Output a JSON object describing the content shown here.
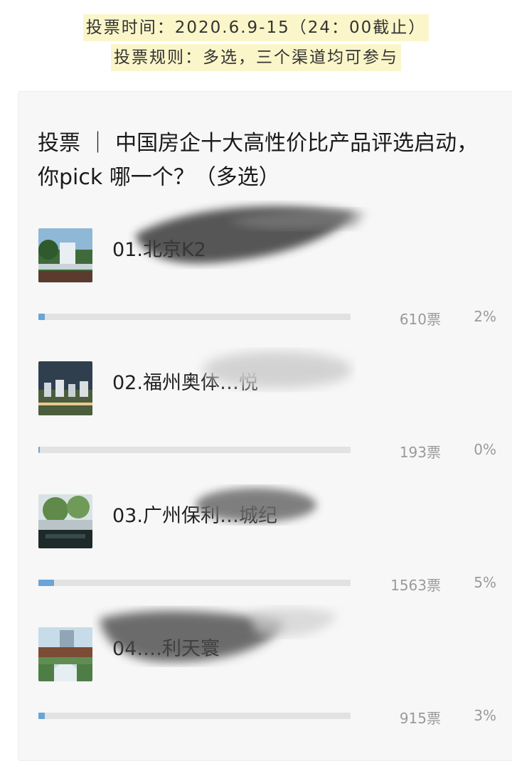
{
  "banner": {
    "line1": "投票时间：2020.6.9-15（24：00截止）",
    "line2": "投票规则：多选，三个渠道均可参与"
  },
  "poll": {
    "title": "投票 ｜ 中国房企十大高性价比产品评选启动，你pick 哪一个？（多选）",
    "options": [
      {
        "label": "01.北京K2",
        "votes": "610票",
        "percent": "2%",
        "fraction": 0.02
      },
      {
        "label": "02.福州奥体…悦",
        "votes": "193票",
        "percent": "0%",
        "fraction": 0.005
      },
      {
        "label": "03.广州保利…城纪",
        "votes": "1563票",
        "percent": "5%",
        "fraction": 0.05
      },
      {
        "label": "04.…利天寰",
        "votes": "915票",
        "percent": "3%",
        "fraction": 0.02
      }
    ]
  },
  "colors": {
    "accent": "#6aa4d8",
    "banner_bg": "#fbf6c9",
    "track": "#e2e2e2"
  }
}
